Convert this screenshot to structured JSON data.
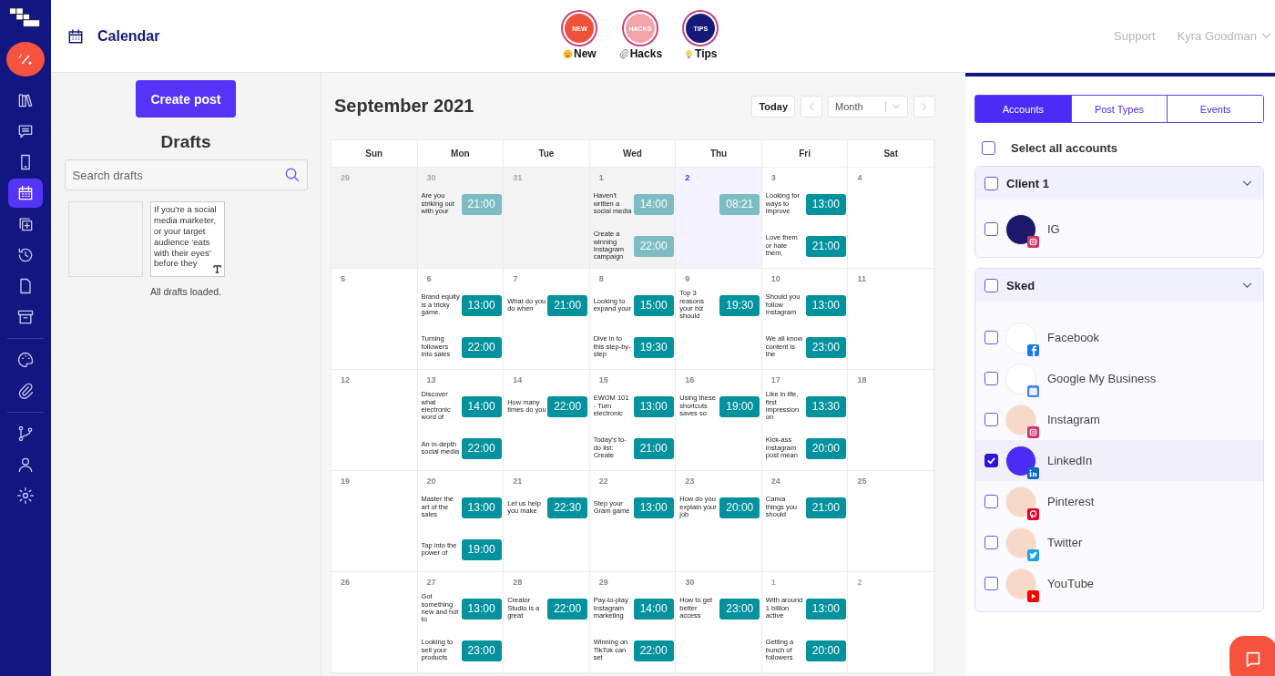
{
  "sidebar": {
    "groups": [
      {
        "items": [
          {
            "selected": false
          },
          {
            "selected": false
          },
          {
            "selected": false
          },
          {
            "selected": true
          },
          {
            "selected": false
          },
          {
            "selected": false
          },
          {
            "selected": false
          },
          {
            "selected": false
          }
        ]
      },
      {
        "items": [
          {
            "selected": false
          },
          {
            "selected": false
          }
        ]
      },
      {
        "items": [
          {
            "selected": false
          },
          {
            "selected": false
          },
          {
            "selected": false
          }
        ]
      }
    ]
  },
  "header": {
    "title": "Calendar",
    "stories": [
      {
        "badge": "NEW",
        "label": "New",
        "color": "#f0513a"
      },
      {
        "badge": "HACKS",
        "label": "Hacks",
        "color": "#f4a3a8"
      },
      {
        "badge": "TIPS",
        "label": "Tips",
        "color": "#16197a"
      }
    ],
    "support": "Support",
    "user": "Kyra Goodman"
  },
  "drafts": {
    "create_button": "Create post",
    "title": "Drafts",
    "search": {
      "placeholder": "Search drafts"
    },
    "cards": [
      {
        "kind": "image"
      },
      {
        "kind": "text",
        "text": "If you’re a social media marketer, or your target audience ‘eats with their eyes’ before they"
      }
    ],
    "status": "All drafts loaded."
  },
  "calendar": {
    "title": "September 2021",
    "today_button": "Today",
    "view": "Month",
    "weekdays": [
      "Sun",
      "Mon",
      "Tue",
      "Wed",
      "Thu",
      "Fri",
      "Sat"
    ],
    "weeks": [
      {
        "days": [
          {
            "day": "29",
            "other_month": true,
            "past": true,
            "today": false
          },
          {
            "day": "30",
            "other_month": true,
            "past": true,
            "today": false,
            "posts": [
              {
                "snippet": "Are you striking out with your",
                "time": "21:00",
                "past": true
              }
            ]
          },
          {
            "day": "31",
            "other_month": true,
            "past": true,
            "today": false
          },
          {
            "day": "1",
            "other_month": false,
            "past": true,
            "today": false,
            "posts": [
              {
                "snippet": "Haven't written a social media",
                "time": "14:00",
                "past": true
              },
              {
                "snippet": "Create a winning Instagram campaign",
                "time": "22:00",
                "past": true
              }
            ]
          },
          {
            "day": "2",
            "other_month": false,
            "past": false,
            "today": true,
            "posts": [
              {
                "time": "08:21",
                "past": true
              }
            ]
          },
          {
            "day": "3",
            "other_month": false,
            "past": false,
            "today": false,
            "posts": [
              {
                "snippet": "Looking for ways to improve",
                "time": "13:00",
                "past": false
              },
              {
                "snippet": "Love them or hate them,",
                "time": "21:00",
                "past": false
              }
            ]
          },
          {
            "day": "4",
            "other_month": false,
            "past": false,
            "today": false
          }
        ]
      },
      {
        "days": [
          {
            "day": "5",
            "other_month": false,
            "past": false,
            "today": false
          },
          {
            "day": "6",
            "other_month": false,
            "past": false,
            "today": false,
            "posts": [
              {
                "snippet": "Brand equity is a tricky game.",
                "time": "13:00",
                "past": false
              },
              {
                "snippet": "Turning followers into sales",
                "time": "22:00",
                "past": false
              }
            ]
          },
          {
            "day": "7",
            "other_month": false,
            "past": false,
            "today": false,
            "posts": [
              {
                "snippet": "What do you do when",
                "time": "21:00",
                "past": false
              }
            ]
          },
          {
            "day": "8",
            "other_month": false,
            "past": false,
            "today": false,
            "posts": [
              {
                "snippet": "Looking to expand your",
                "time": "15:00",
                "past": false
              },
              {
                "snippet": "Dive in to this step-by-step",
                "time": "19:30",
                "past": false
              }
            ]
          },
          {
            "day": "9",
            "other_month": false,
            "past": false,
            "today": false,
            "posts": [
              {
                "snippet": "Top 3 reasons your biz should",
                "time": "19:30",
                "past": false
              }
            ]
          },
          {
            "day": "10",
            "other_month": false,
            "past": false,
            "today": false,
            "posts": [
              {
                "snippet": "Should you follow Instagram",
                "time": "13:00",
                "past": false
              },
              {
                "snippet": "We all know content is the",
                "time": "23:00",
                "past": false
              }
            ]
          },
          {
            "day": "11",
            "other_month": false,
            "past": false,
            "today": false
          }
        ]
      },
      {
        "days": [
          {
            "day": "12",
            "other_month": false,
            "past": false,
            "today": false
          },
          {
            "day": "13",
            "other_month": false,
            "past": false,
            "today": false,
            "posts": [
              {
                "snippet": "Discover what electronic word of",
                "time": "14:00",
                "past": false
              },
              {
                "snippet": "An in-depth social media",
                "time": "22:00",
                "past": false
              }
            ]
          },
          {
            "day": "14",
            "other_month": false,
            "past": false,
            "today": false,
            "posts": [
              {
                "snippet": "How many times do you",
                "time": "22:00",
                "past": false
              }
            ]
          },
          {
            "day": "15",
            "other_month": false,
            "past": false,
            "today": false,
            "posts": [
              {
                "snippet": "EWOM 101 - Turn electronic",
                "time": "13:00",
                "past": false
              },
              {
                "snippet": "Today's to-do list: Create",
                "time": "21:00",
                "past": false
              }
            ]
          },
          {
            "day": "16",
            "other_month": false,
            "past": false,
            "today": false,
            "posts": [
              {
                "snippet": "Using these shortcuts saves so",
                "time": "19:00",
                "past": false
              }
            ]
          },
          {
            "day": "17",
            "other_month": false,
            "past": false,
            "today": false,
            "posts": [
              {
                "snippet": "Like in life, first impression on",
                "time": "13:30",
                "past": false
              },
              {
                "snippet": "Kick-ass Instagram post mean",
                "time": "20:00",
                "past": false
              }
            ]
          },
          {
            "day": "18",
            "other_month": false,
            "past": false,
            "today": false
          }
        ]
      },
      {
        "days": [
          {
            "day": "19",
            "other_month": false,
            "past": false,
            "today": false
          },
          {
            "day": "20",
            "other_month": false,
            "past": false,
            "today": false,
            "posts": [
              {
                "snippet": "Master the art of the sales",
                "time": "13:00",
                "past": false
              },
              {
                "snippet": "Tap into the power of",
                "time": "19:00",
                "past": false
              }
            ]
          },
          {
            "day": "21",
            "other_month": false,
            "past": false,
            "today": false,
            "posts": [
              {
                "snippet": "Let us help you make",
                "time": "22:30",
                "past": false
              }
            ]
          },
          {
            "day": "22",
            "other_month": false,
            "past": false,
            "today": false,
            "posts": [
              {
                "snippet": "Step your Gram game",
                "time": "13:00",
                "past": false
              }
            ]
          },
          {
            "day": "23",
            "other_month": false,
            "past": false,
            "today": false,
            "posts": [
              {
                "snippet": "How do you explain your job",
                "time": "20:00",
                "past": false
              }
            ]
          },
          {
            "day": "24",
            "other_month": false,
            "past": false,
            "today": false,
            "posts": [
              {
                "snippet": "Canva things you should",
                "time": "21:00",
                "past": false
              }
            ]
          },
          {
            "day": "25",
            "other_month": false,
            "past": false,
            "today": false
          }
        ]
      },
      {
        "days": [
          {
            "day": "26",
            "other_month": false,
            "past": false,
            "today": false
          },
          {
            "day": "27",
            "other_month": false,
            "past": false,
            "today": false,
            "posts": [
              {
                "snippet": "Got something new and hot to",
                "time": "13:00",
                "past": false
              },
              {
                "snippet": "Looking to sell your products",
                "time": "23:00",
                "past": false
              }
            ]
          },
          {
            "day": "28",
            "other_month": false,
            "past": false,
            "today": false,
            "posts": [
              {
                "snippet": "Creator Studio is a great",
                "time": "22:00",
                "past": false
              }
            ]
          },
          {
            "day": "29",
            "other_month": false,
            "past": false,
            "today": false,
            "posts": [
              {
                "snippet": "Pay-to-play Instagram marketing",
                "time": "14:00",
                "past": false
              },
              {
                "snippet": "Winning on TikTok can set",
                "time": "22:00",
                "past": false
              }
            ]
          },
          {
            "day": "30",
            "other_month": false,
            "past": false,
            "today": false,
            "posts": [
              {
                "snippet": "How to get better access",
                "time": "23:00",
                "past": false
              }
            ]
          },
          {
            "day": "1",
            "other_month": true,
            "past": false,
            "today": false,
            "posts": [
              {
                "snippet": "With around 1 billion active",
                "time": "13:00",
                "past": false
              },
              {
                "snippet": "Getting a bunch of followers",
                "time": "20:00",
                "past": false
              }
            ]
          },
          {
            "day": "2",
            "other_month": true,
            "past": false,
            "today": false
          }
        ]
      }
    ]
  },
  "accounts_panel": {
    "tabs": [
      {
        "label": "Accounts",
        "selected": true
      },
      {
        "label": "Post Types",
        "selected": false
      },
      {
        "label": "Events",
        "selected": false
      }
    ],
    "select_all": {
      "label": "Select all accounts",
      "checked": false
    },
    "groups": [
      {
        "name": "Client 1",
        "checked": false,
        "expanded": true,
        "accounts": [
          {
            "name": "IG",
            "kind": "instagram",
            "checked": false,
            "color": "#1d1a6e"
          }
        ]
      },
      {
        "name": "Sked",
        "checked": false,
        "expanded": true,
        "accounts": [
          {
            "name": "Facebook",
            "kind": "facebook",
            "checked": false,
            "color": "#ffffff"
          },
          {
            "name": "Google My Business",
            "kind": "gmb",
            "checked": false,
            "color": "#ffffff"
          },
          {
            "name": "Instagram",
            "kind": "instagram",
            "checked": false,
            "color": "#f8d9c8"
          },
          {
            "name": "LinkedIn",
            "kind": "linkedin",
            "checked": true,
            "color": "#4b2bf5"
          },
          {
            "name": "Pinterest",
            "kind": "pinterest",
            "checked": false,
            "color": "#f8d9c8"
          },
          {
            "name": "Twitter",
            "kind": "twitter",
            "checked": false,
            "color": "#f8d9c8"
          },
          {
            "name": "YouTube",
            "kind": "youtube",
            "checked": false,
            "color": "#f8d9c8"
          }
        ]
      }
    ]
  }
}
